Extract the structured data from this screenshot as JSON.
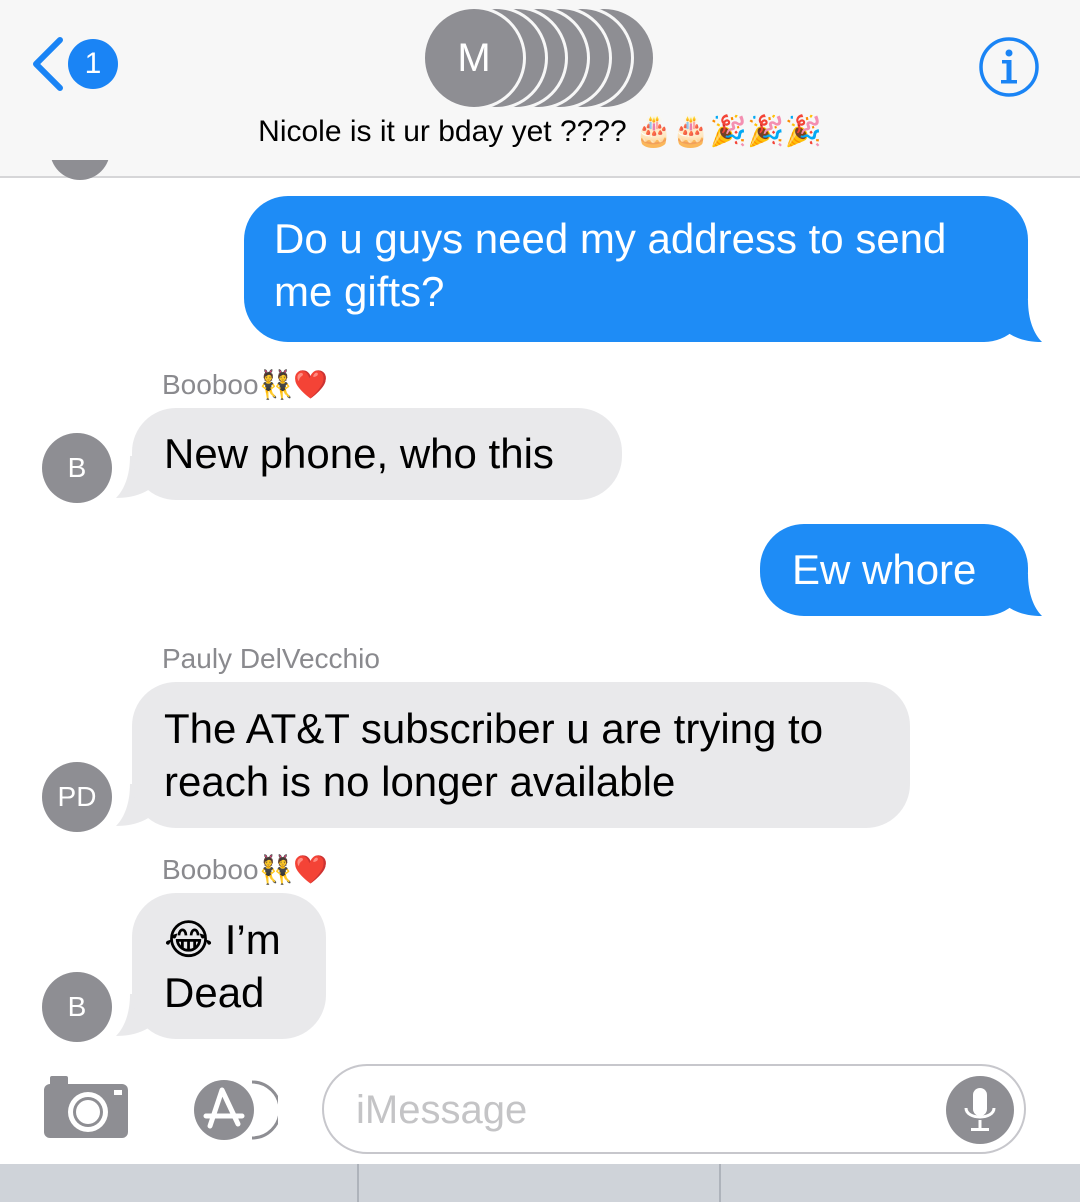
{
  "header": {
    "back_count": "1",
    "avatar_initial": "M",
    "group_name": "Nicole is it ur bday yet ????",
    "group_emoji": "🎂🎂🎉🎉🎉",
    "icons": [
      "chevron-left-icon",
      "info-icon"
    ]
  },
  "messages": [
    {
      "direction": "outgoing",
      "text_line1": "Do u guys need my address to send",
      "text_line2": "me gifts?"
    },
    {
      "direction": "incoming",
      "sender": "Booboo",
      "sender_emoji": "👯❤️",
      "initials": "B",
      "text": "New phone, who this"
    },
    {
      "direction": "outgoing",
      "text": "Ew whore"
    },
    {
      "direction": "incoming",
      "sender": "Pauly DelVecchio",
      "initials": "PD",
      "text_line1": "The AT&T subscriber u are trying to",
      "text_line2": "reach is no longer available"
    },
    {
      "direction": "incoming",
      "sender": "Booboo",
      "sender_emoji": "👯❤️",
      "initials": "B",
      "text_emoji": "😂",
      "text_line1": "I’m",
      "text_line2": "Dead"
    }
  ],
  "input": {
    "placeholder": "iMessage",
    "icons": [
      "camera-icon",
      "app-store-icon",
      "microphone-icon"
    ]
  },
  "colors": {
    "outgoing_bubble": "#1e8cf6",
    "incoming_bubble": "#e9e9eb",
    "accent": "#1a84f5",
    "avatar_gray": "#8e8e93"
  }
}
